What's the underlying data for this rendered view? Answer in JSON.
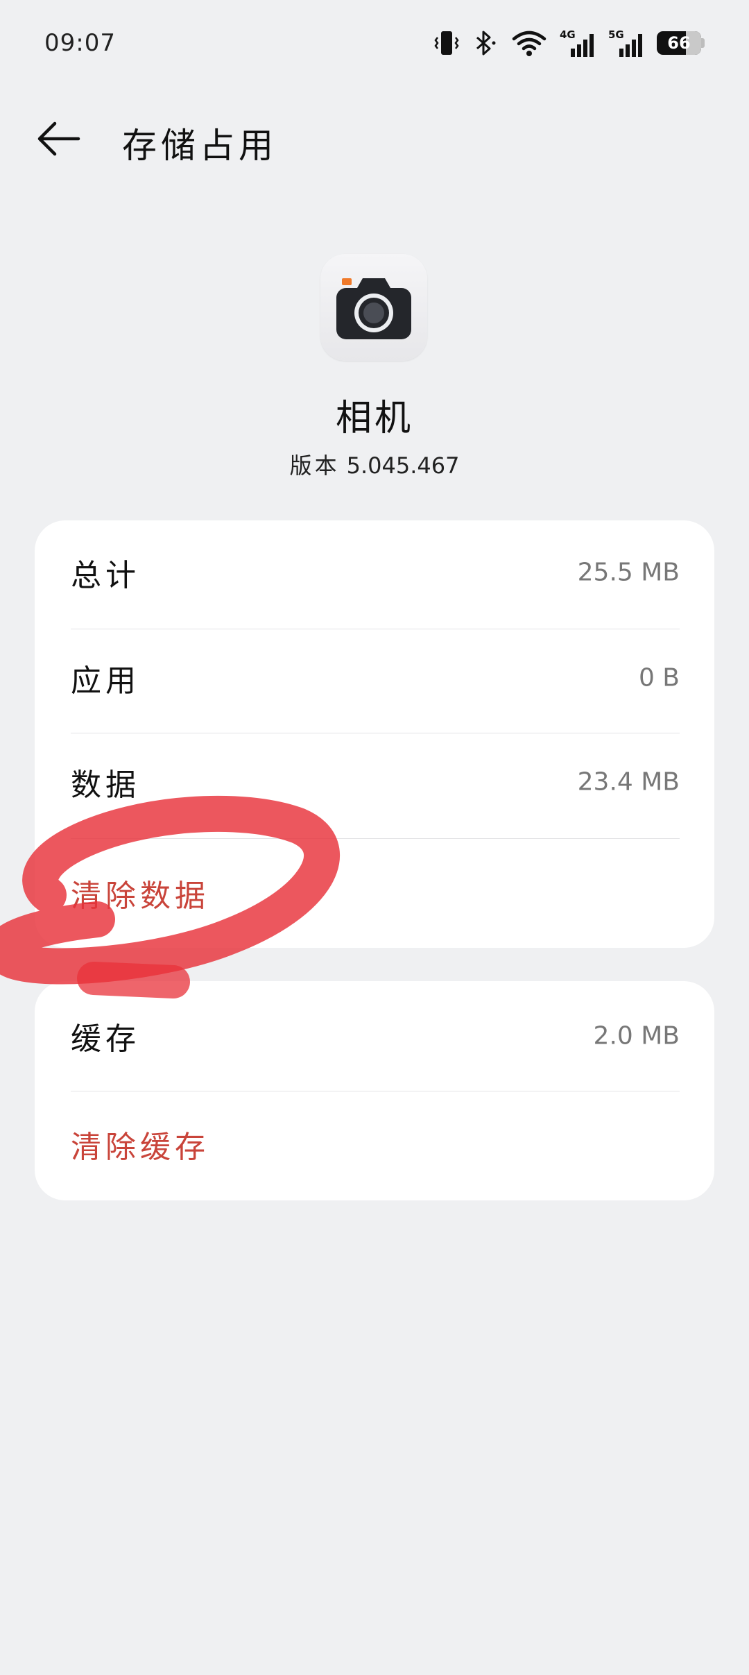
{
  "status_bar": {
    "time": "09:07",
    "battery_level": "66",
    "network_labels": [
      "4G",
      "5G"
    ]
  },
  "header": {
    "title": "存储占用",
    "back_icon": "arrow-left-icon"
  },
  "app": {
    "icon": "camera-icon",
    "name": "相机",
    "version_label": "版本",
    "version_value": "5.045.467"
  },
  "storage_card": {
    "rows": [
      {
        "label": "总计",
        "value": "25.5 MB"
      },
      {
        "label": "应用",
        "value": "0 B"
      },
      {
        "label": "数据",
        "value": "23.4 MB"
      }
    ],
    "clear_data_label": "清除数据"
  },
  "cache_card": {
    "label": "缓存",
    "value": "2.0 MB",
    "clear_cache_label": "清除缓存"
  },
  "colors": {
    "background": "#eff0f2",
    "card": "#ffffff",
    "action_red": "#c9443a",
    "annotation_red": "#e8323a"
  }
}
